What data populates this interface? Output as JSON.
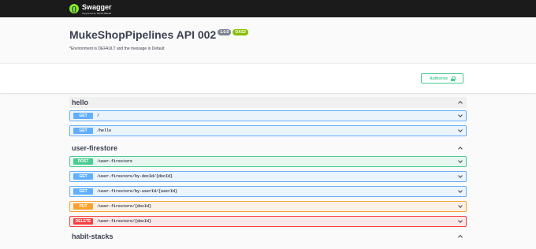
{
  "topbar": {
    "logo_name": "Swagger",
    "logo_sub": "Supported by SMARTBEAR"
  },
  "info": {
    "title": "MukeShopPipelines API 002",
    "version_badge": "1.0.0",
    "oas_badge": "OAS3",
    "description": "*Environment is DEFAULT and the message is Default"
  },
  "authorize": {
    "label": "Authorize"
  },
  "colors": {
    "get": "#61affe",
    "post": "#49cc90",
    "put": "#fca130",
    "delete": "#f93e3e"
  },
  "tags": [
    {
      "name": "hello",
      "operations": [
        {
          "method": "GET",
          "path": "/"
        },
        {
          "method": "GET",
          "path": "/hello"
        }
      ]
    },
    {
      "name": "user-firestore",
      "operations": [
        {
          "method": "POST",
          "path": "/user-firestore"
        },
        {
          "method": "GET",
          "path": "/user-firestore/by-docId/{docId}"
        },
        {
          "method": "GET",
          "path": "/user-firestore/by-userId/{userId}"
        },
        {
          "method": "PUT",
          "path": "/user-firestore/{docId}"
        },
        {
          "method": "DELETE",
          "path": "/user-firestore/{docId}"
        }
      ]
    },
    {
      "name": "habit-stacks",
      "operations": []
    }
  ]
}
